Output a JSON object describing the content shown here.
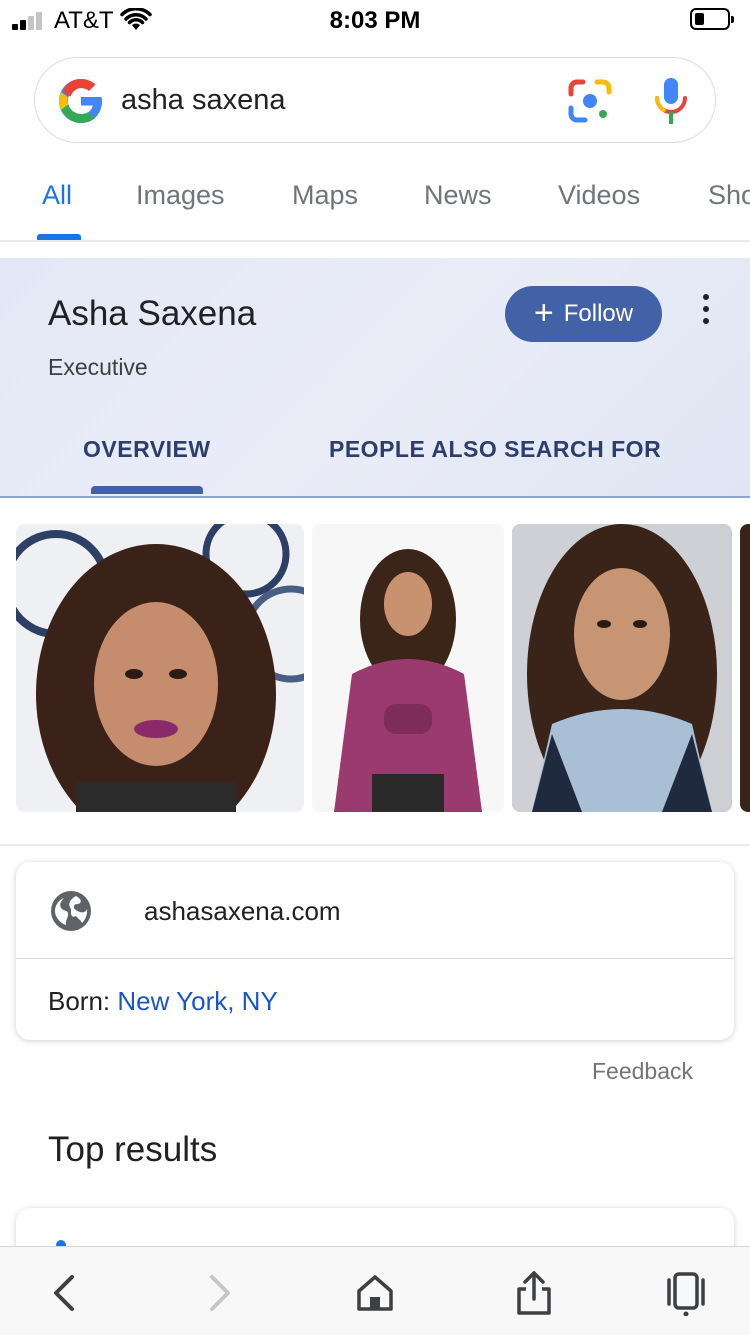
{
  "status_bar": {
    "carrier": "AT&T",
    "time": "8:03 PM"
  },
  "search": {
    "query": "asha saxena"
  },
  "tabs": [
    {
      "label": "All",
      "active": true
    },
    {
      "label": "Images"
    },
    {
      "label": "Maps"
    },
    {
      "label": "News"
    },
    {
      "label": "Videos"
    },
    {
      "label": "Sho"
    }
  ],
  "knowledge_panel": {
    "name": "Asha Saxena",
    "subtitle": "Executive",
    "follow_label": "Follow",
    "tabs": [
      "OVERVIEW",
      "PEOPLE ALSO SEARCH FOR"
    ],
    "website": "ashasaxena.com",
    "born_label": "Born:",
    "born_value": "New York, NY"
  },
  "feedback_label": "Feedback",
  "top_results_heading": "Top results",
  "colors": {
    "accent": "#1a73e8",
    "follow_button": "#4361a6",
    "link": "#1a55c8"
  }
}
